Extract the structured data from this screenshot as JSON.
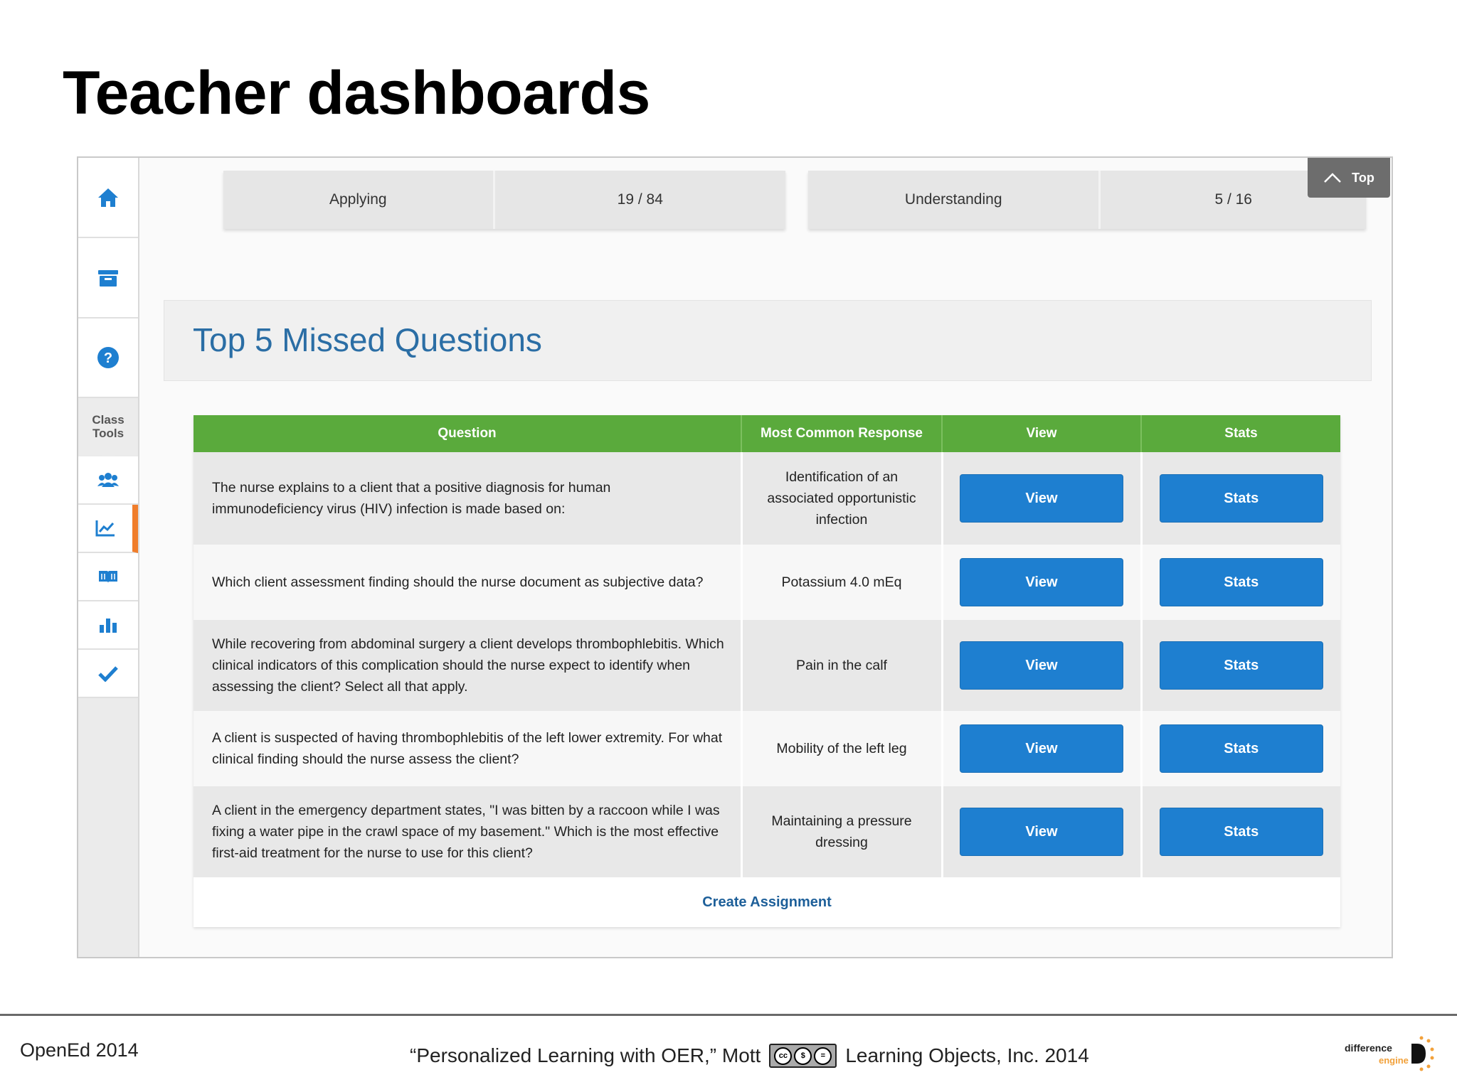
{
  "slide": {
    "title": "Teacher dashboards"
  },
  "sidebar": {
    "class_tools_label": "Class\nTools"
  },
  "scores": [
    {
      "label": "Applying",
      "value": "19 / 84"
    },
    {
      "label": "Understanding",
      "value": "5 / 16"
    }
  ],
  "top_button": {
    "label": "Top"
  },
  "panel": {
    "title": "Top 5 Missed Questions"
  },
  "table": {
    "headers": [
      "Question",
      "Most Common Response",
      "View",
      "Stats"
    ],
    "rows": [
      {
        "question": "The nurse explains to a client that a positive diagnosis for human immunodeficiency virus (HIV) infection is made based on:",
        "response": "Identification of an associated opportunistic infection",
        "view": "View",
        "stats": "Stats"
      },
      {
        "question": "Which client assessment finding should the nurse document as subjective data?",
        "response": "Potassium 4.0 mEq",
        "view": "View",
        "stats": "Stats"
      },
      {
        "question": "While recovering from abdominal surgery a client develops thrombophlebitis. Which clinical indicators of this complication should the nurse expect to identify when assessing the client? Select all that apply.",
        "response": "Pain in the calf",
        "view": "View",
        "stats": "Stats"
      },
      {
        "question": "A client is suspected of having thrombophlebitis of the left lower extremity. For what clinical finding should the nurse assess the client?",
        "response": "Mobility of the left leg",
        "view": "View",
        "stats": "Stats"
      },
      {
        "question": "A client in the emergency department states, \"I was bitten by a raccoon while I was fixing a water pipe in the crawl space of my basement.\" Which is the most effective first-aid treatment for the nurse to use for this client?",
        "response": "Maintaining a pressure dressing",
        "view": "View",
        "stats": "Stats"
      }
    ],
    "create_label": "Create Assignment"
  },
  "footer": {
    "left": "OpenEd 2014",
    "citation_before": "“Personalized Learning with OER,” Mott",
    "citation_after": "Learning Objects, Inc. 2014",
    "logo_line1": "difference",
    "logo_line2": "engine"
  },
  "colors": {
    "header_green": "#5aaa3c",
    "button_blue": "#1e7fd0",
    "title_blue": "#2b6ea5",
    "active_orange": "#f07d2b"
  },
  "icons": [
    "home-icon",
    "inbox-icon",
    "help-icon",
    "users-icon",
    "line-chart-icon",
    "book-icon",
    "bar-chart-icon",
    "check-icon",
    "chevron-up-icon",
    "cc-license-icon"
  ]
}
